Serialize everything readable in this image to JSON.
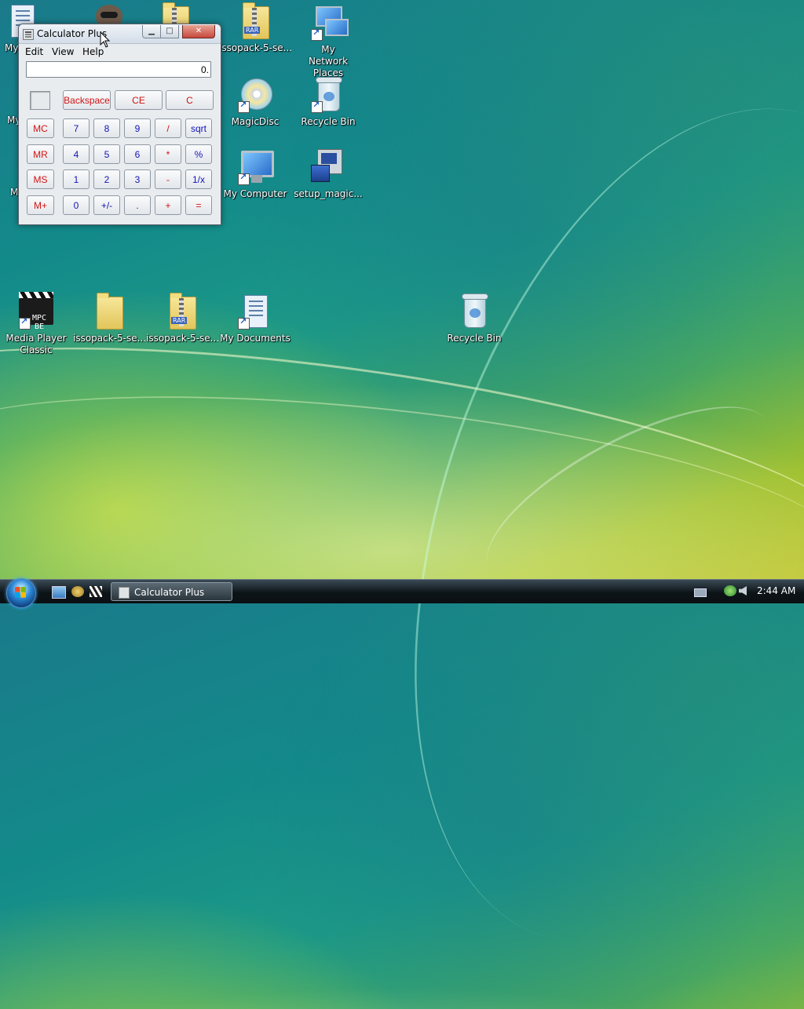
{
  "desktop": {
    "icons": [
      {
        "label": "My",
        "type": "doc"
      },
      {
        "label": "My",
        "type": "doc"
      },
      {
        "label": "M",
        "type": "doc"
      },
      {
        "label": "",
        "type": "raccoon"
      },
      {
        "label": "",
        "type": "folder"
      },
      {
        "label": "issopack-5-se...",
        "type": "rar"
      },
      {
        "label": "My Network Places",
        "type": "network"
      },
      {
        "label": "MagicDisc",
        "type": "disc"
      },
      {
        "label": "Recycle Bin",
        "type": "bin"
      },
      {
        "label": "My Computer",
        "type": "computer"
      },
      {
        "label": "setup_magic...",
        "type": "setup"
      },
      {
        "label": "Media Player Classic",
        "type": "mpc"
      },
      {
        "label": "issopack-5-se...",
        "type": "folder"
      },
      {
        "label": "issopack-5-se...",
        "type": "rar"
      },
      {
        "label": "My Documents",
        "type": "doc"
      },
      {
        "label": "Recycle Bin",
        "type": "bin"
      }
    ],
    "mpc_icon_text": "MPC BE",
    "rar_badge": "RAR"
  },
  "calculator": {
    "title": "Calculator Plus",
    "title_buttons": {
      "minimize": "▁",
      "maximize": "□",
      "close": "✕"
    },
    "menu": [
      "Edit",
      "View",
      "Help"
    ],
    "display_value": "0.",
    "top_buttons": [
      "Backspace",
      "CE",
      "C"
    ],
    "memory_buttons": [
      "MC",
      "MR",
      "MS",
      "M+"
    ],
    "keypad": [
      [
        "7",
        "8",
        "9",
        "/",
        "sqrt"
      ],
      [
        "4",
        "5",
        "6",
        "*",
        "%"
      ],
      [
        "1",
        "2",
        "3",
        "-",
        "1/x"
      ],
      [
        "0",
        "+/-",
        ".",
        "+",
        "="
      ]
    ]
  },
  "taskbar": {
    "task_label": "Calculator Plus",
    "clock": "2:44 AM"
  }
}
